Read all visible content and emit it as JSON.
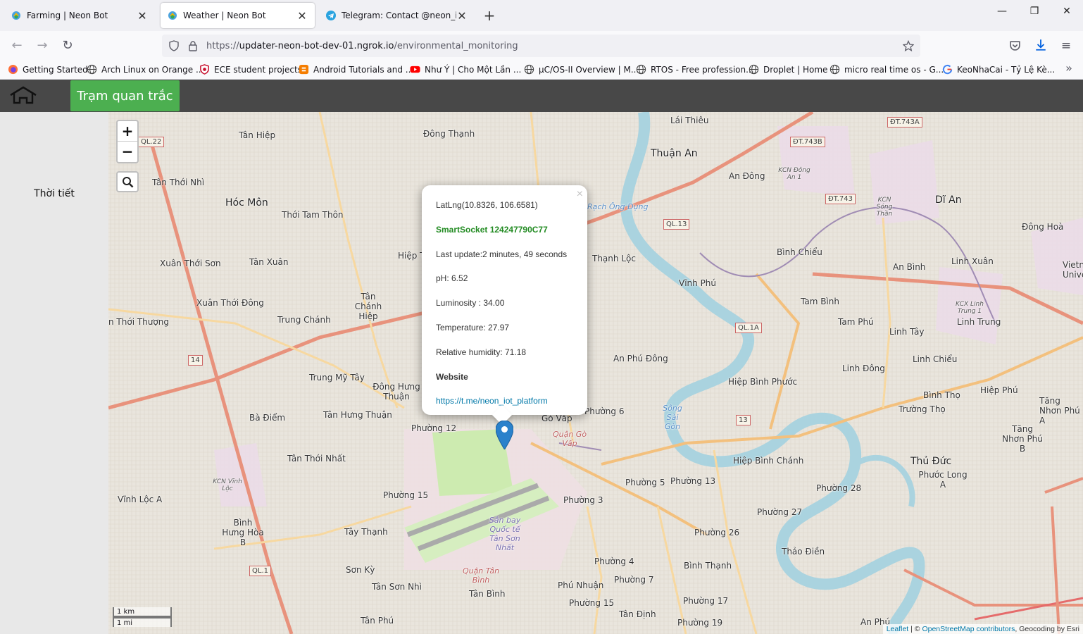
{
  "browser": {
    "tabs": [
      {
        "title": "Farming | Neon Bot",
        "active": false
      },
      {
        "title": "Weather | Neon Bot",
        "active": true
      },
      {
        "title": "Telegram: Contact @neon_iot_p",
        "active": false
      }
    ],
    "url_scheme": "https://",
    "url_host": "updater-neon-bot-dev-01.ngrok.io",
    "url_path": "/environmental_monitoring",
    "bookmarks": [
      {
        "label": "Getting Started",
        "icon": "firefox-icon"
      },
      {
        "label": "Arch Linux on Orange ...",
        "icon": "globe-icon"
      },
      {
        "label": "ECE student projects",
        "icon": "shield-red-icon"
      },
      {
        "label": "Android Tutorials and ...",
        "icon": "blogger-icon"
      },
      {
        "label": "Như Ý | Cho Một Lần ...",
        "icon": "youtube-icon"
      },
      {
        "label": "µC/OS-II Overview | M...",
        "icon": "globe-icon"
      },
      {
        "label": "RTOS - Free profession...",
        "icon": "globe-icon"
      },
      {
        "label": "Droplet | Home",
        "icon": "globe-icon"
      },
      {
        "label": "micro real time os - G...",
        "icon": "globe-icon"
      },
      {
        "label": "KeoNhaCai - Tỷ Lệ Kè...",
        "icon": "google-icon"
      }
    ]
  },
  "page": {
    "station_button": "Trạm quan trắc",
    "sidebar_link": "Thời tiết"
  },
  "map": {
    "zoom_in": "+",
    "zoom_out": "−",
    "popup": {
      "latlng": "LatLng(10.8326, 106.6581)",
      "device": "SmartSocket 124247790C77",
      "last_update": "Last update:2 minutes, 49 seconds",
      "ph": "pH: 6.52",
      "luminosity": "Luminosity : 34.00",
      "temperature": "Temperature: 27.97",
      "humidity": "Relative humidity: 71.18",
      "website_label": "Website",
      "website_link": "https://t.me/neon_iot_platform",
      "close": "×"
    },
    "scale_km": "1 km",
    "scale_mi": "1 mi",
    "attribution_leaflet": "Leaflet",
    "attribution_sep": " | © ",
    "attribution_osm": "OpenStreetMap contributors",
    "attribution_esri": ", Geocoding by Esri",
    "labels": {
      "l1": "Tân Hiệp",
      "l2": "Đông Thạnh",
      "l3": "Lái Thiêu",
      "l4": "Thuận An",
      "l5": "An Đông",
      "l6": "Dĩ An",
      "l7": "Đông Hoà",
      "l8": "Tân Thới Nhì",
      "l9": "Hóc Môn",
      "l10": "Thới Tam Thôn",
      "l11": "Xuân Thới Sơn",
      "l12": "Tân Xuân",
      "l13": "Hiệp T",
      "l14": "Thạnh Lộc",
      "l15": "Bình Chiểu",
      "l16": "An Bình",
      "l17": "Linh Xuân",
      "l18": "Xuân Thới Đông",
      "l19": "Tân Chánh Hiệp",
      "l20": "Vĩnh Phú",
      "l21": "Tam Bình",
      "l22": "Tam Phú",
      "l23": "Linh Tây",
      "l24": "Linh Trung",
      "l25": "n Thới Thượng",
      "l26": "Trung Chánh",
      "l27": "An Phú Đông",
      "l28": "Linh Đông",
      "l29": "Linh Chiểu",
      "l30": "Trung Mỹ Tây",
      "l31": "Đông Hưng Thuận",
      "l32": "Hiệp Bình Phước",
      "l33": "Bình Thọ",
      "l34": "Hiệp Phú",
      "l35": "Tăng Nhơn Phú A",
      "l36": "Bà Điểm",
      "l37": "Tân Hưng Thuận",
      "l38": "Phường 6",
      "l39": "Gò Vấp",
      "l40": "Trường Thọ",
      "l41": "Tăng Nhơn Phú B",
      "l42": "Phường 12",
      "l43": "Tân Thới Nhất",
      "l44": "Hiệp Bình Chánh",
      "l45": "Thủ Đức",
      "l46": "Phước Long A",
      "l47": "Phường 5",
      "l48": "Phường 13",
      "l49": "Phường 28",
      "l50": "Vĩnh Lộc A",
      "l51": "Phường 15",
      "l52": "Phường 3",
      "l53": "Phường 27",
      "l54": "Bình Hưng Hòa B",
      "l55": "Tây Thạnh",
      "l56": "Phường 26",
      "l57": "Thảo Điền",
      "l58": "Phường 4",
      "l59": "Bình Thạnh",
      "l60": "Sơn Kỳ",
      "l61": "Phường 7",
      "l62": "Tân Sơn Nhì",
      "l63": "Phú Nhuận",
      "l64": "Phường 17",
      "l65": "Tân Bình",
      "l66": "Phường 15",
      "l67": "Tân Phú",
      "l68": "Tân Định",
      "l69": "Phường 19",
      "l70": "An Phú",
      "l71": "Vietn Unive",
      "l72": "Quận Gò Vấp",
      "l73": "Sân bay Quốc tế Tân Sơn Nhất",
      "l74": "Quận Tân Bình",
      "l75": "KCN Vĩnh Lộc",
      "l76": "KCN Đông An 1",
      "l77": "KCN Sóng Thần",
      "l78": "KCX Linh Trung 1",
      "l79": "Sông Sài Gòn",
      "l80": "Rạch Ông Đụng"
    },
    "shields": {
      "s1": "QL.22",
      "s2": "ĐT.743A",
      "s3": "ĐT.743B",
      "s4": "ĐT.743",
      "s5": "QL.13",
      "s6": "QL.1A",
      "s7": "14",
      "s8": "13",
      "s9": "QL.1"
    }
  }
}
